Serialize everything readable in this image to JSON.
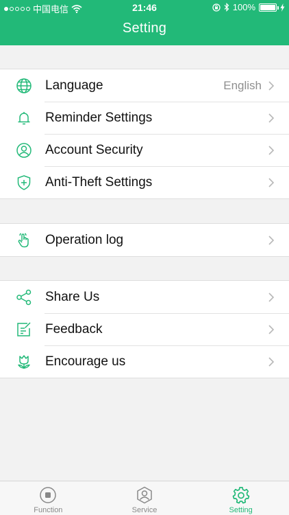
{
  "status": {
    "carrier": "中国电信",
    "time": "21:46",
    "battery": "100%",
    "battery_level": 1.0
  },
  "header": {
    "title": "Setting"
  },
  "groups": [
    {
      "items": [
        {
          "label": "Language",
          "value": "English",
          "icon": "globe-icon"
        },
        {
          "label": "Reminder Settings",
          "icon": "bell-icon"
        },
        {
          "label": "Account Security",
          "icon": "user-circle-icon"
        },
        {
          "label": "Anti-Theft Settings",
          "icon": "shield-plus-icon"
        }
      ]
    },
    {
      "items": [
        {
          "label": "Operation log",
          "icon": "hand-tap-icon"
        }
      ]
    },
    {
      "items": [
        {
          "label": "Share Us",
          "icon": "share-icon"
        },
        {
          "label": "Feedback",
          "icon": "edit-note-icon"
        },
        {
          "label": "Encourage us",
          "icon": "flower-icon"
        }
      ]
    }
  ],
  "tabs": [
    {
      "label": "Function",
      "icon": "stop-circle-icon",
      "active": false
    },
    {
      "label": "Service",
      "icon": "user-hexagon-icon",
      "active": false
    },
    {
      "label": "Setting",
      "icon": "gear-icon",
      "active": true
    }
  ],
  "colors": {
    "accent": "#22b978",
    "inactive": "#888888"
  }
}
